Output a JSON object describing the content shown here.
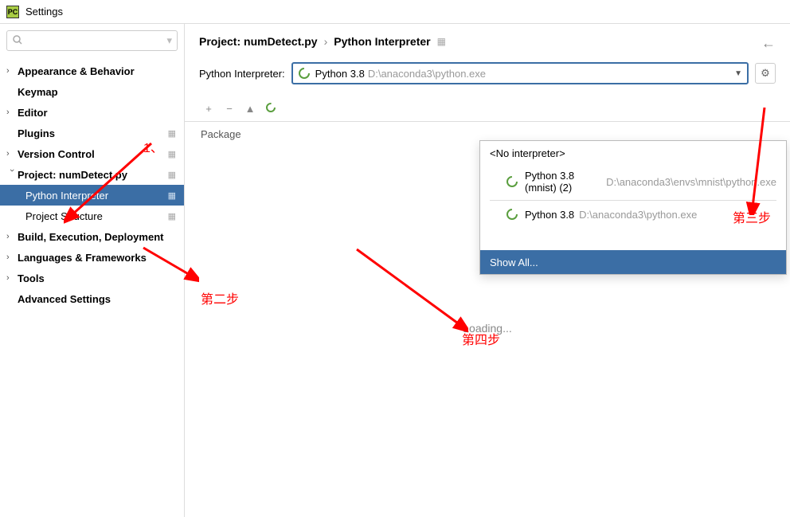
{
  "window": {
    "title": "Settings"
  },
  "search": {
    "placeholder": ""
  },
  "sidebar": {
    "items": [
      {
        "label": "Appearance & Behavior",
        "expandable": true,
        "bold": true
      },
      {
        "label": "Keymap",
        "expandable": false,
        "bold": true
      },
      {
        "label": "Editor",
        "expandable": true,
        "bold": true
      },
      {
        "label": "Plugins",
        "expandable": false,
        "bold": true,
        "gear": true
      },
      {
        "label": "Version Control",
        "expandable": true,
        "bold": true,
        "gear": true
      },
      {
        "label": "Project: numDetect.py",
        "expandable": true,
        "expanded": true,
        "bold": true,
        "gear": true
      },
      {
        "label": "Python Interpreter",
        "sub": true,
        "selected": true,
        "gear": true
      },
      {
        "label": "Project Structure",
        "sub": true,
        "gear": true
      },
      {
        "label": "Build, Execution, Deployment",
        "expandable": true,
        "bold": true
      },
      {
        "label": "Languages & Frameworks",
        "expandable": true,
        "bold": true
      },
      {
        "label": "Tools",
        "expandable": true,
        "bold": true
      },
      {
        "label": "Advanced Settings",
        "expandable": false,
        "bold": true
      }
    ]
  },
  "breadcrumb": {
    "items": [
      "Project: numDetect.py",
      "Python Interpreter"
    ]
  },
  "interpreter": {
    "label": "Python Interpreter:",
    "selected_name": "Python 3.8",
    "selected_path": "D:\\anaconda3\\python.exe"
  },
  "dropdown": {
    "no_interpreter": "<No interpreter>",
    "options": [
      {
        "name": "Python 3.8 (mnist) (2)",
        "path": "D:\\anaconda3\\envs\\mnist\\python.exe"
      },
      {
        "name": "Python 3.8",
        "path": "D:\\anaconda3\\python.exe"
      }
    ],
    "show_all": "Show All..."
  },
  "toolbar": {
    "add": "+",
    "remove": "−",
    "up": "▲"
  },
  "table": {
    "header_package": "Package"
  },
  "status": {
    "loading": "Loading..."
  },
  "annotations": {
    "step1": "1、",
    "step2": "第二步",
    "step3": "第三步",
    "step4": "第四步"
  }
}
